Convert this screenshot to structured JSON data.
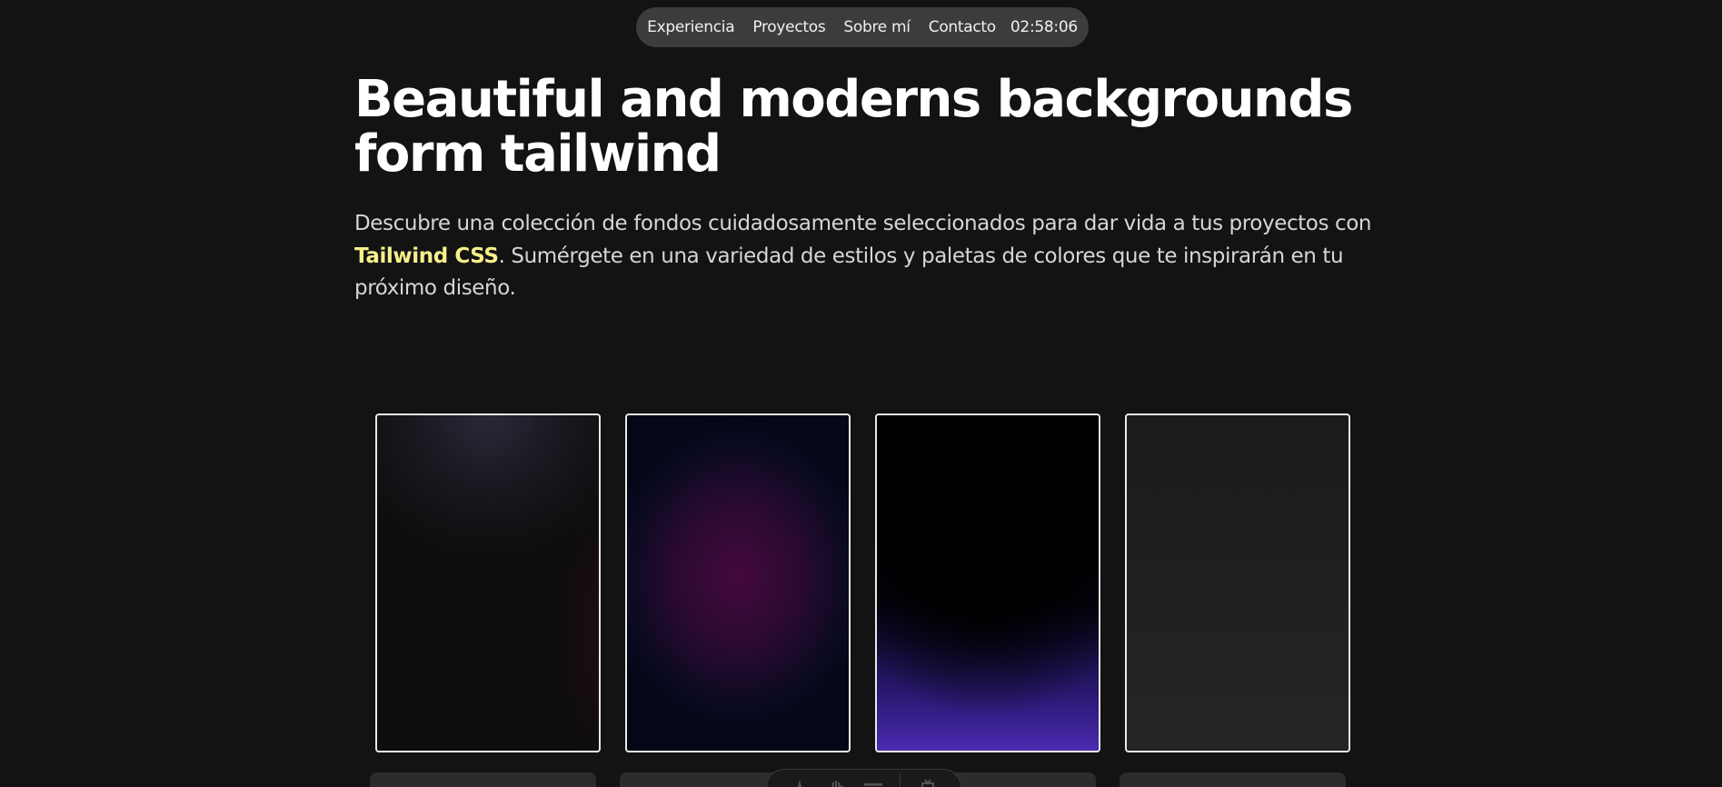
{
  "nav": {
    "links": [
      "Experiencia",
      "Proyectos",
      "Sobre mí",
      "Contacto"
    ],
    "clock": "02:58:06"
  },
  "hero": {
    "title": "Beautiful and moderns backgrounds form tailwind",
    "description_before": "Descubre una colección de fondos cuidadosamente seleccionados para dar vida a tus proyectos con ",
    "description_highlight": "Tailwind CSS",
    "description_after": ". Sumérgete en una variedad de estilos y paletas de colores que te inspirarán en tu próximo diseño."
  },
  "colors": {
    "page_background": "#131313",
    "nav_background": "#3c3c3c",
    "highlight": "#f7ef8a",
    "card_border": "#e8e8e8"
  },
  "dock": {
    "icons": [
      "paint-icon",
      "hand-icon",
      "menu-icon",
      "gift-icon"
    ]
  }
}
